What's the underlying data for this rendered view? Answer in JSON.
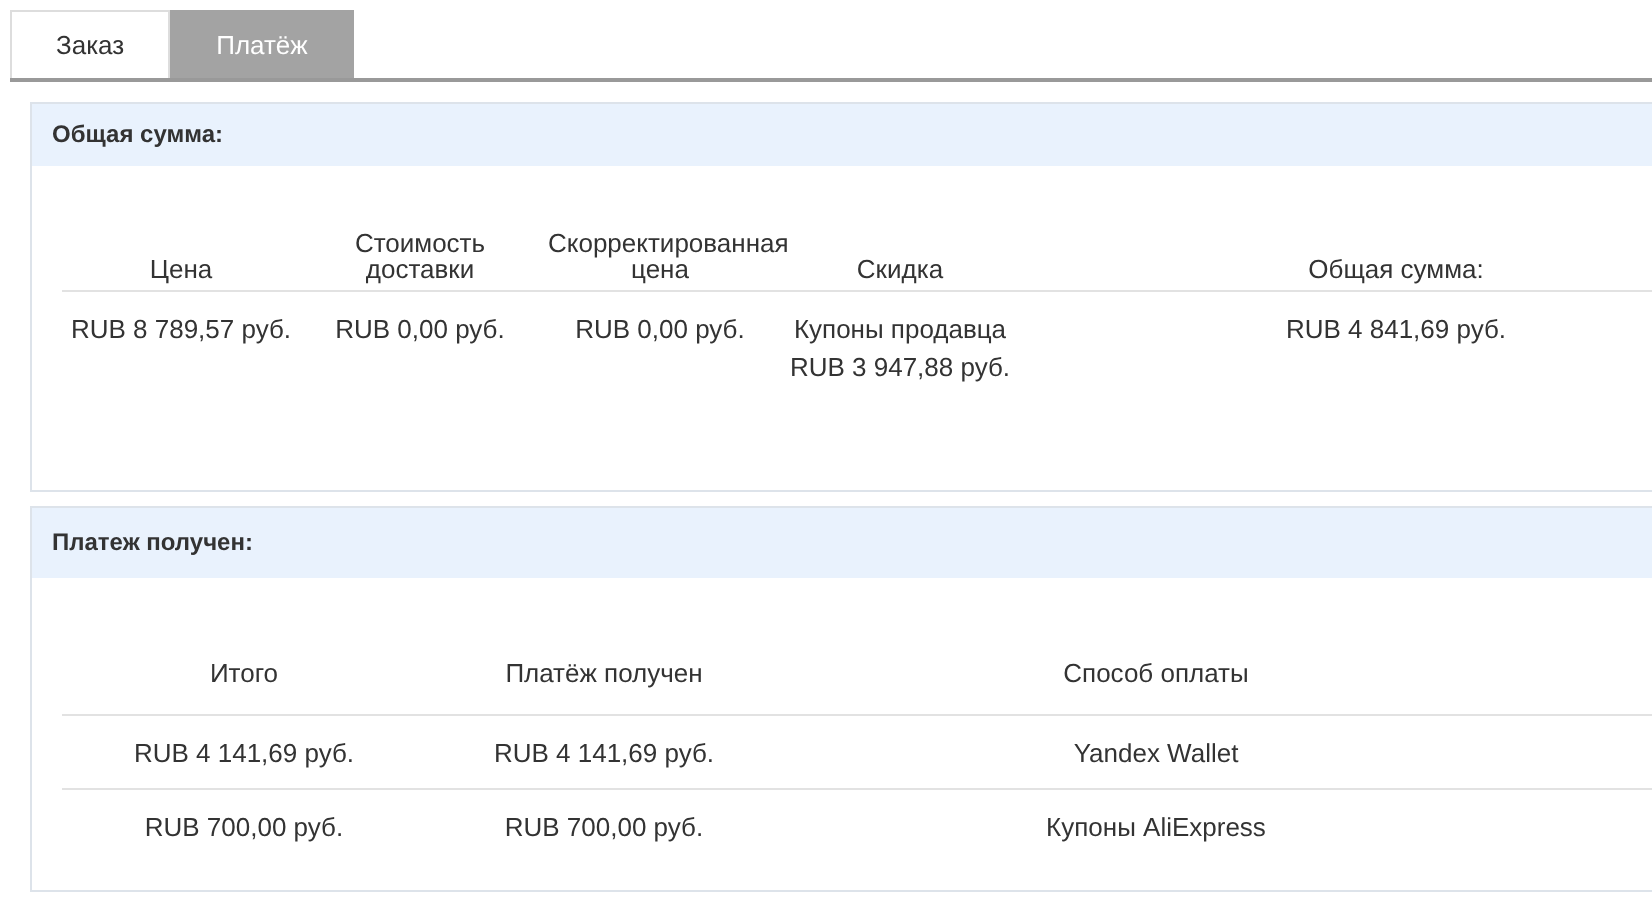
{
  "tabs": [
    {
      "label": "Заказ",
      "selected": false
    },
    {
      "label": "Платёж",
      "selected": true
    }
  ],
  "panels": [
    {
      "title": "Общая сумма:",
      "columns": [
        "Цена",
        "Стоимость доставки",
        "Скорректированная цена",
        "Скидка",
        "Общая сумма:"
      ],
      "rows": [
        [
          "RUB 8 789,57 руб.",
          "RUB 0,00 руб.",
          "RUB 0,00 руб.",
          "Купоны продавца RUB 3 947,88 руб.",
          "RUB 4 841,69 руб."
        ]
      ]
    },
    {
      "title": "Платеж получен:",
      "columns": [
        "Итого",
        "Платёж получен",
        "Способ оплаты"
      ],
      "rows": [
        [
          "RUB 4 141,69 руб.",
          "RUB 4 141,69 руб.",
          "Yandex Wallet"
        ],
        [
          "RUB 700,00 руб.",
          "RUB 700,00 руб.",
          "Купоны AliExpress"
        ]
      ]
    }
  ]
}
